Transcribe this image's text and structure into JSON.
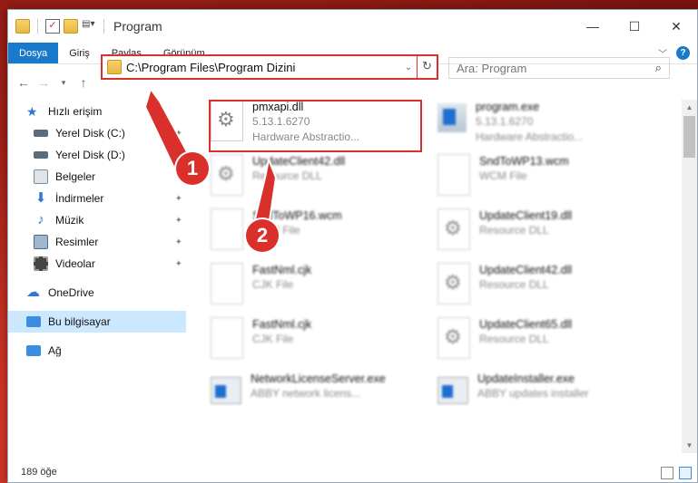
{
  "window": {
    "title": "Program",
    "controls": {
      "minimize": "—",
      "maximize": "☐",
      "close": "✕"
    }
  },
  "ribbon": {
    "tabs": [
      "Dosya",
      "Giriş",
      "Paylaş",
      "Görünüm"
    ]
  },
  "address": {
    "path": "C:\\Program Files\\Program Dizini",
    "search_placeholder": "Ara: Program"
  },
  "nav": {
    "items": [
      {
        "label": "Hızlı erişim",
        "icon": "star-icon",
        "color": "#2b79d6"
      },
      {
        "label": "Yerel Disk (C:)",
        "icon": "drive-icon",
        "color": "#5a6b7c"
      },
      {
        "label": "Yerel Disk (D:)",
        "icon": "drive-icon",
        "color": "#5a6b7c"
      },
      {
        "label": "Belgeler",
        "icon": "documents-icon",
        "color": "#7c8aa0"
      },
      {
        "label": "İndirmeler",
        "icon": "download-icon",
        "color": "#2b79d6"
      },
      {
        "label": "Müzik",
        "icon": "music-icon",
        "color": "#2b79d6"
      },
      {
        "label": "Resimler",
        "icon": "pictures-icon",
        "color": "#4a6b8e"
      },
      {
        "label": "Videolar",
        "icon": "video-icon",
        "color": "#444"
      },
      {
        "label": "OneDrive",
        "icon": "cloud-icon",
        "color": "#2b79d6"
      },
      {
        "label": "Bu bilgisayar",
        "icon": "computer-icon",
        "color": "#3a8de0"
      },
      {
        "label": "Ağ",
        "icon": "network-icon",
        "color": "#3a8de0"
      }
    ]
  },
  "files": [
    {
      "name": "pmxapi.dll",
      "line1": "5.13.1.6270",
      "line2": "Hardware Abstractio...",
      "icon": "gear"
    },
    {
      "name": "program.exe",
      "line1": "5.13.1.6270",
      "line2": "Hardware Abstractio...",
      "icon": "exe"
    },
    {
      "name": "UpdateClient42.dll",
      "line1": "Resource DLL",
      "icon": "gear"
    },
    {
      "name": "SndToWP13.wcm",
      "line1": "WCM File",
      "icon": "plain"
    },
    {
      "name": "SndToWP16.wcm",
      "line1": "WCM File",
      "icon": "plain"
    },
    {
      "name": "UpdateClient19.dll",
      "line1": "Resource DLL",
      "icon": "gear"
    },
    {
      "name": "FastNml.cjk",
      "line1": "CJK File",
      "icon": "plain"
    },
    {
      "name": "UpdateClient42.dll",
      "line1": "Resource DLL",
      "icon": "gear"
    },
    {
      "name": "FastNml.cjk",
      "line1": "CJK File",
      "icon": "plain"
    },
    {
      "name": "UpdateClient65.dll",
      "line1": "Resource DLL",
      "icon": "gear"
    },
    {
      "name": "NetworkLicenseServer.exe",
      "line1": "ABBY network licens...",
      "icon": "win"
    },
    {
      "name": "UpdateInstaller.exe",
      "line1": "ABBY updates installer",
      "icon": "win"
    }
  ],
  "status": {
    "count": "189 öğe"
  },
  "annotations": {
    "badge1": "1",
    "badge2": "2"
  }
}
